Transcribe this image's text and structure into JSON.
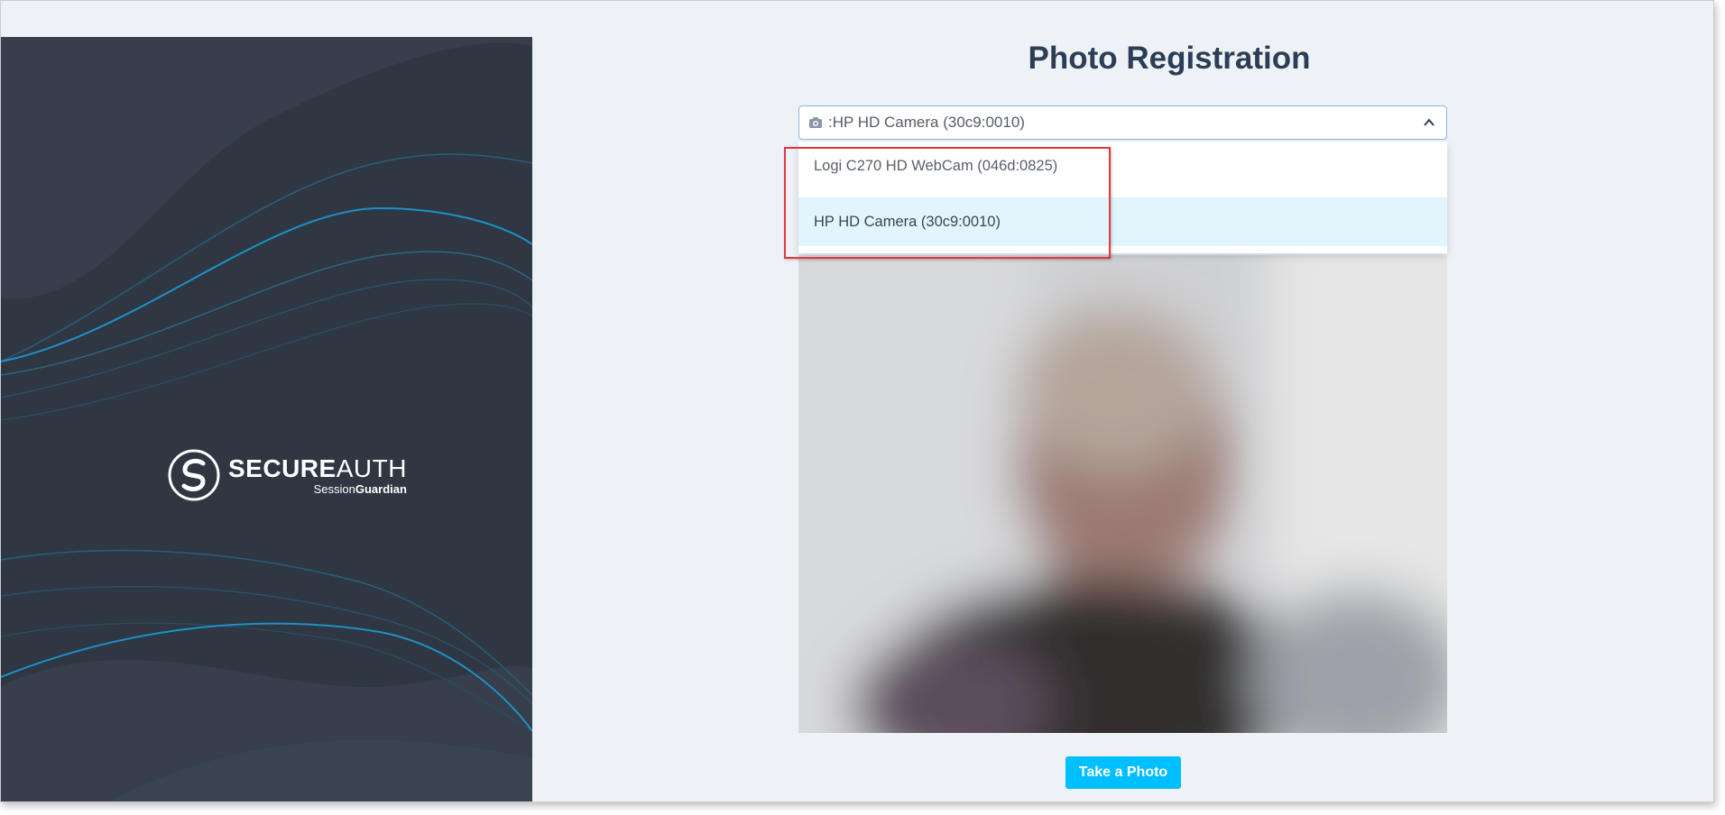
{
  "page": {
    "title": "Photo Registration"
  },
  "brand": {
    "name_bold": "SECURE",
    "name_light": "AUTH",
    "product_regular": "Session",
    "product_bold": "Guardian"
  },
  "camera_select": {
    "icon": "camera-icon",
    "selected_value": ":HP HD Camera (30c9:0010)",
    "expanded": true,
    "options": [
      {
        "label": "Logi C270 HD WebCam (046d:0825)",
        "selected": false
      },
      {
        "label": "HP HD Camera (30c9:0010)",
        "selected": true
      }
    ]
  },
  "actions": {
    "take_photo_label": "Take a Photo"
  },
  "colors": {
    "panel_bg": "#2e3742",
    "page_bg": "#eef2f7",
    "accent": "#00bfff",
    "highlight": "#e0393e",
    "title": "#2c3e55"
  }
}
